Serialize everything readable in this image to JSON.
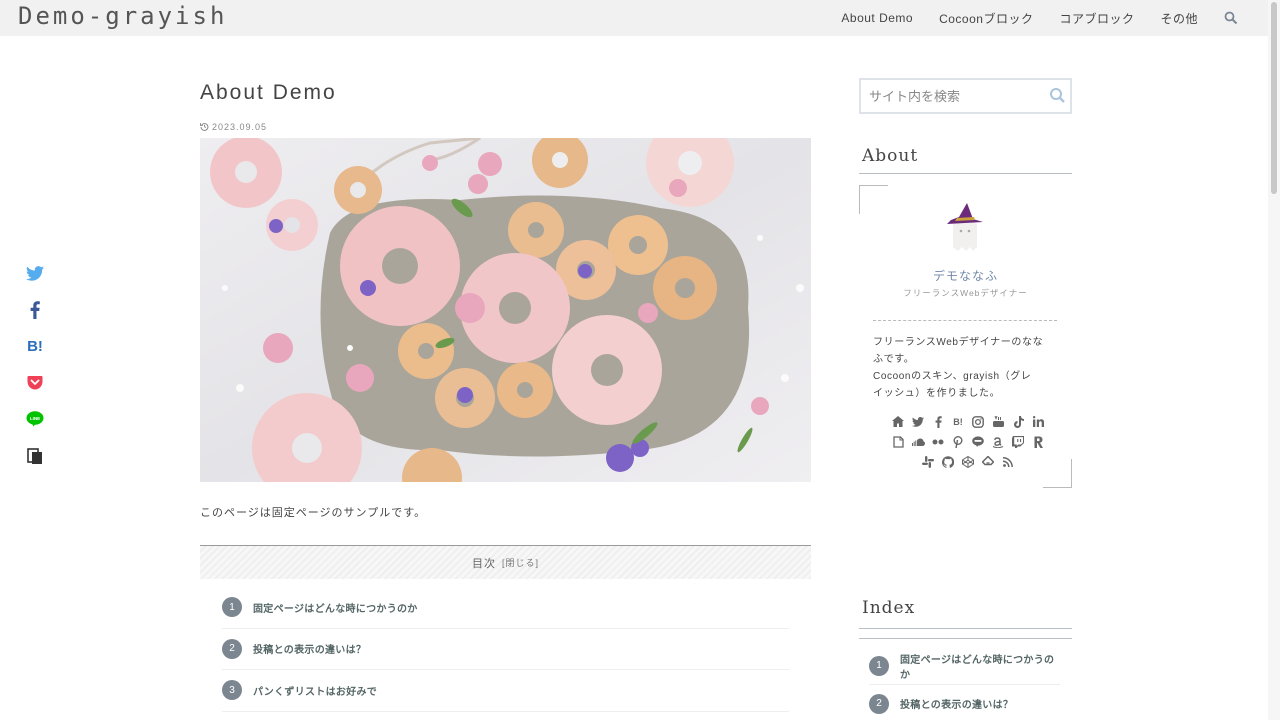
{
  "site": {
    "title": "Demo-grayish"
  },
  "nav": {
    "items": [
      "About Demo",
      "Cocoonブロック",
      "コアブロック",
      "その他"
    ]
  },
  "share": {
    "icons": [
      "twitter-icon",
      "facebook-icon",
      "hatena-icon",
      "pocket-icon",
      "line-icon",
      "copy-icon"
    ],
    "hatena_label": "B!",
    "line_label": "LINE"
  },
  "article": {
    "title": "About Demo",
    "date": "2023.09.05",
    "body": "このページは固定ページのサンプルです。"
  },
  "toc": {
    "heading": "目次",
    "toggle": "[閉じる]",
    "items": [
      {
        "num": "1",
        "label": "固定ページはどんな時につかうのか"
      },
      {
        "num": "2",
        "label": "投稿との表示の違いは？"
      },
      {
        "num": "3",
        "label": "パンくずリストはお好みで"
      }
    ]
  },
  "sidebar": {
    "search_placeholder": "サイト内を検索",
    "about": {
      "title": "About",
      "name": "デモななふ",
      "role": "フリーランスWebデザイナー",
      "desc_lines": [
        "フリーランスWebデザイナーのなな",
        "ふです。",
        "Cocoonのスキン、grayish（グレ",
        "イッシュ）を作りました。"
      ],
      "hatena_label": "B!",
      "sns_icons": [
        "home-icon",
        "twitter-icon",
        "facebook-icon",
        "hatena-icon",
        "instagram-icon",
        "youtube-icon",
        "tiktok-icon",
        "linkedin-icon",
        "note-icon",
        "soundcloud-icon",
        "flickr-icon",
        "pinterest-icon",
        "line-icon",
        "amazon-icon",
        "twitch-icon",
        "rakuten-icon",
        "slack-icon",
        "github-icon",
        "codepen-icon",
        "feedly-icon",
        "rss-icon"
      ]
    },
    "index": {
      "title": "Index",
      "items": [
        {
          "num": "1",
          "label": "固定ページはどんな時につかうのか"
        },
        {
          "num": "2",
          "label": "投稿との表示の違いは？"
        }
      ]
    }
  },
  "colors": {
    "header_bg": "#f1f1f1",
    "accent": "#7088a8",
    "num_badge": "#7c8690"
  }
}
